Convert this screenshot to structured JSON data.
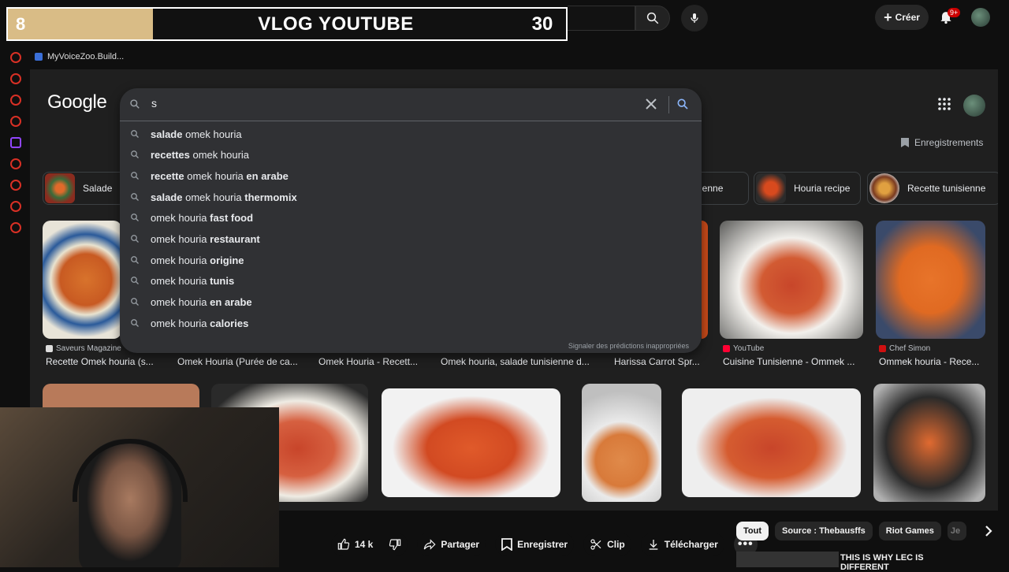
{
  "stream_banner": {
    "left_number": "8",
    "title": "VLOG YOUTUBE",
    "right_number": "30"
  },
  "yt_header": {
    "create_label": "Créer",
    "notif_count": "9+"
  },
  "bookmark": {
    "label": "MyVoiceZoo.Build..."
  },
  "google": {
    "logo": "Google",
    "saves_label": "Enregistrements",
    "search_value": "s",
    "suggestions": [
      {
        "bold_pre": "salade",
        "normal": " omek houria",
        "bold_post": ""
      },
      {
        "bold_pre": "recettes",
        "normal": " omek houria",
        "bold_post": ""
      },
      {
        "bold_pre": "recette",
        "normal": " omek houria ",
        "bold_post": "en arabe"
      },
      {
        "bold_pre": "salade",
        "normal": " omek houria ",
        "bold_post": "thermomix"
      },
      {
        "bold_pre": "",
        "normal": "omek houria ",
        "bold_post": "fast food"
      },
      {
        "bold_pre": "",
        "normal": "omek houria ",
        "bold_post": "restaurant"
      },
      {
        "bold_pre": "",
        "normal": "omek houria ",
        "bold_post": "origine"
      },
      {
        "bold_pre": "",
        "normal": "omek houria ",
        "bold_post": "tunis"
      },
      {
        "bold_pre": "",
        "normal": "omek houria ",
        "bold_post": "en arabe"
      },
      {
        "bold_pre": "",
        "normal": "omek houria ",
        "bold_post": "calories"
      }
    ],
    "report_link": "Signaler des prédictions inappropriées",
    "chips": [
      {
        "label": "Salade"
      },
      {
        "label": "unisienne"
      },
      {
        "label": "Houria recipe"
      },
      {
        "label": "Recette tunisienne"
      }
    ],
    "results_row1": [
      {
        "source": "Saveurs Magazine",
        "title": "Recette Omek houria (s..."
      },
      {
        "source": "",
        "title": "Omek Houria (Purée de ca..."
      },
      {
        "source": "",
        "title": "Omek Houria - Recett..."
      },
      {
        "source": "",
        "title": "Omek houria, salade tunisienne d..."
      },
      {
        "source": "",
        "title": "Harissa Carrot Spr..."
      },
      {
        "source": "YouTube",
        "title": "Cuisine Tunisienne - Ommek ..."
      },
      {
        "source": "Chef Simon",
        "title": "Ommek houria - Rece..."
      }
    ]
  },
  "yt_actions": {
    "like_count": "14 k",
    "share": "Partager",
    "save": "Enregistrer",
    "clip": "Clip",
    "download": "Télécharger"
  },
  "yt_chips": [
    "Tout",
    "Source : Thebausffs",
    "Riot Games",
    "Je"
  ],
  "next_video_title": "THIS IS WHY LEC IS DIFFERENT",
  "colors": {
    "accent_red": "#cc0000",
    "google_bg": "#1f1f1f",
    "search_bg": "#303134"
  }
}
